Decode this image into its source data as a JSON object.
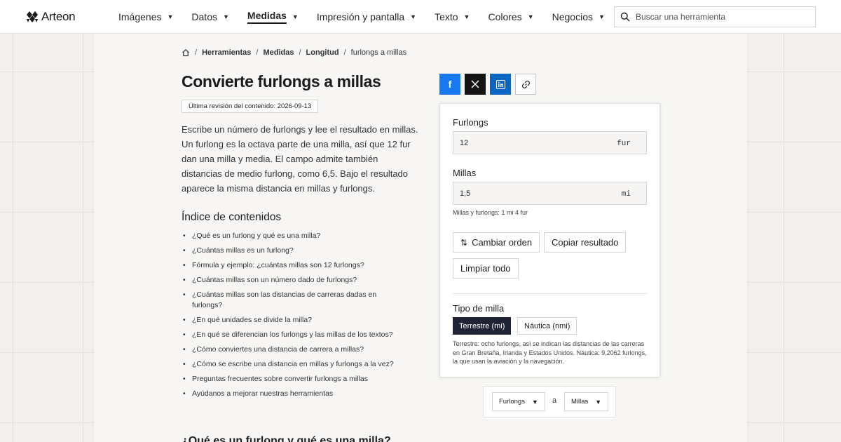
{
  "header": {
    "logo_text": "Arteon",
    "nav": [
      {
        "label": "Imágenes",
        "active": false
      },
      {
        "label": "Datos",
        "active": false
      },
      {
        "label": "Medidas",
        "active": true
      },
      {
        "label": "Impresión y pantalla",
        "active": false
      },
      {
        "label": "Texto",
        "active": false
      },
      {
        "label": "Colores",
        "active": false
      },
      {
        "label": "Negocios",
        "active": false
      }
    ],
    "search_placeholder": "Buscar una herramienta"
  },
  "breadcrumb": [
    "Herramientas",
    "Medidas",
    "Longitud",
    "furlongs a millas"
  ],
  "page": {
    "title": "Convierte furlongs a millas",
    "revised": "Última revisión del contenido: 2026-09-13",
    "intro": "Escribe un número de furlongs y lee el resultado en millas. Un furlong es la octava parte de una milla, así que 12 fur dan una milla y media. El campo admite también distancias de medio furlong, como 6,5. Bajo el resultado aparece la misma distancia en millas y furlongs.",
    "toc_title": "Índice de contenidos",
    "toc": [
      "¿Qué es un furlong y qué es una milla?",
      "¿Cuántas millas es un furlong?",
      "Fórmula y ejemplo: ¿cuántas millas son 12 furlongs?",
      "¿Cuántas millas son un número dado de furlongs?",
      "¿Cuántas millas son las distancias de carreras dadas en furlongs?",
      "¿En qué unidades se divide la milla?",
      "¿En qué se diferencian los furlongs y las millas de los textos?",
      "¿Cómo conviertes una distancia de carrera a millas?",
      "¿Cómo se escribe una distancia en millas y furlongs a la vez?",
      "Preguntas frecuentes sobre convertir furlongs a millas",
      "Ayúdanos a mejorar nuestras herramientas"
    ],
    "next_section_title": "¿Qué es un furlong y qué es una milla?"
  },
  "converter": {
    "furlongs_label": "Furlongs",
    "furlongs_value": "12",
    "furlongs_unit": "fur",
    "miles_label": "Millas",
    "miles_value": "1,5",
    "miles_unit": "mi",
    "mixed_hint": "Millas y furlongs: 1 mi 4 fur",
    "swap_label": "Cambiar orden",
    "copy_label": "Copiar resultado",
    "clear_label": "Limpiar todo",
    "mile_type_label": "Tipo de milla",
    "mile_type_options": [
      "Terrestre (mi)",
      "Náutica (nmi)"
    ],
    "mile_type_selected": "Terrestre (mi)",
    "mile_note": "Terrestre: ocho furlongs, así se indican las distancias de las carreras en Gran Bretaña, Irlanda y Estados Unidos. Náutica: 9,2062 furlongs, la que usan la aviación y la navegación."
  },
  "unit_switch": {
    "from": "Furlongs",
    "connector": "a",
    "to": "Millas"
  },
  "colors": {
    "facebook": "#1877f2",
    "x": "#141414",
    "linkedin": "#0a66c2",
    "selected_segment": "#1f2333"
  }
}
